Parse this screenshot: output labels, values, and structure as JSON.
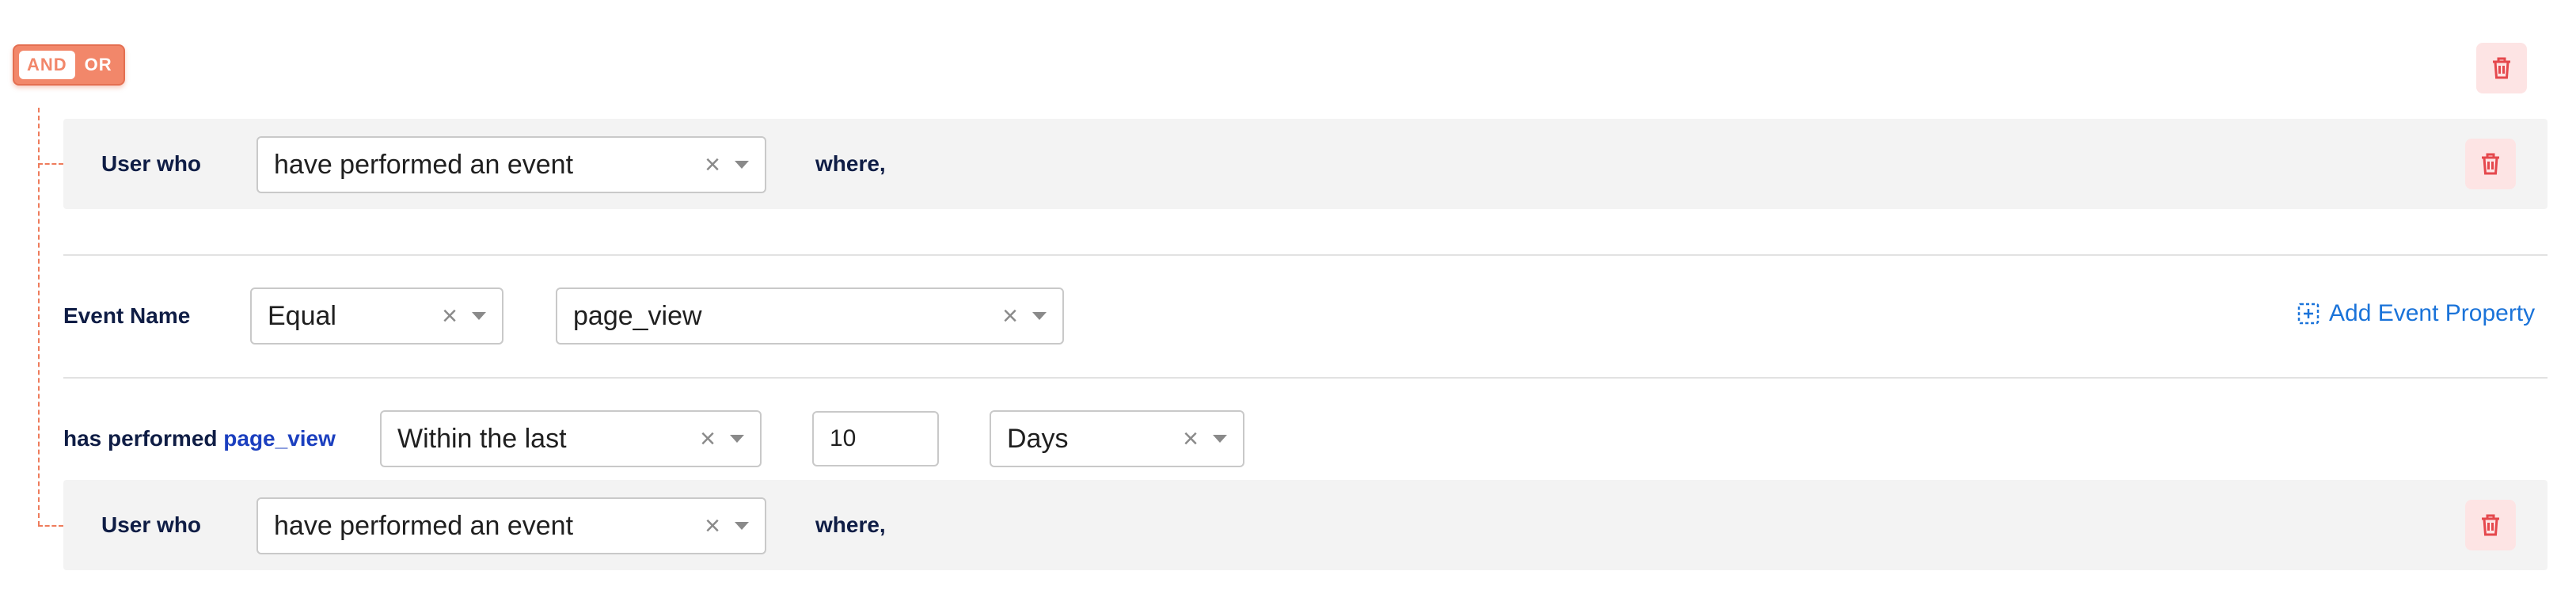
{
  "logic": {
    "and_label": "AND",
    "or_label": "OR"
  },
  "condition1": {
    "user_label": "User who",
    "action_value": "have performed an event",
    "where_label": "where,"
  },
  "event_filter": {
    "label": "Event Name",
    "operator_value": "Equal",
    "event_value": "page_view",
    "add_property_label": "Add Event Property"
  },
  "performed": {
    "prefix": "has performed",
    "event_name": "page_view",
    "time_operator": "Within the last",
    "amount": "10",
    "unit": "Days"
  },
  "condition2": {
    "user_label": "User who",
    "action_value": "have performed an event",
    "where_label": "where,"
  },
  "icons": {
    "delete": "trash-icon",
    "clear": "close-icon",
    "dropdown": "chevron-down-icon",
    "add": "add-box-icon"
  },
  "colors": {
    "accent_orange": "#f2876a",
    "delete_red": "#e5484d",
    "delete_bg": "#fde4e4",
    "link_blue": "#1a73d9",
    "panel_bg": "#f3f3f3"
  }
}
